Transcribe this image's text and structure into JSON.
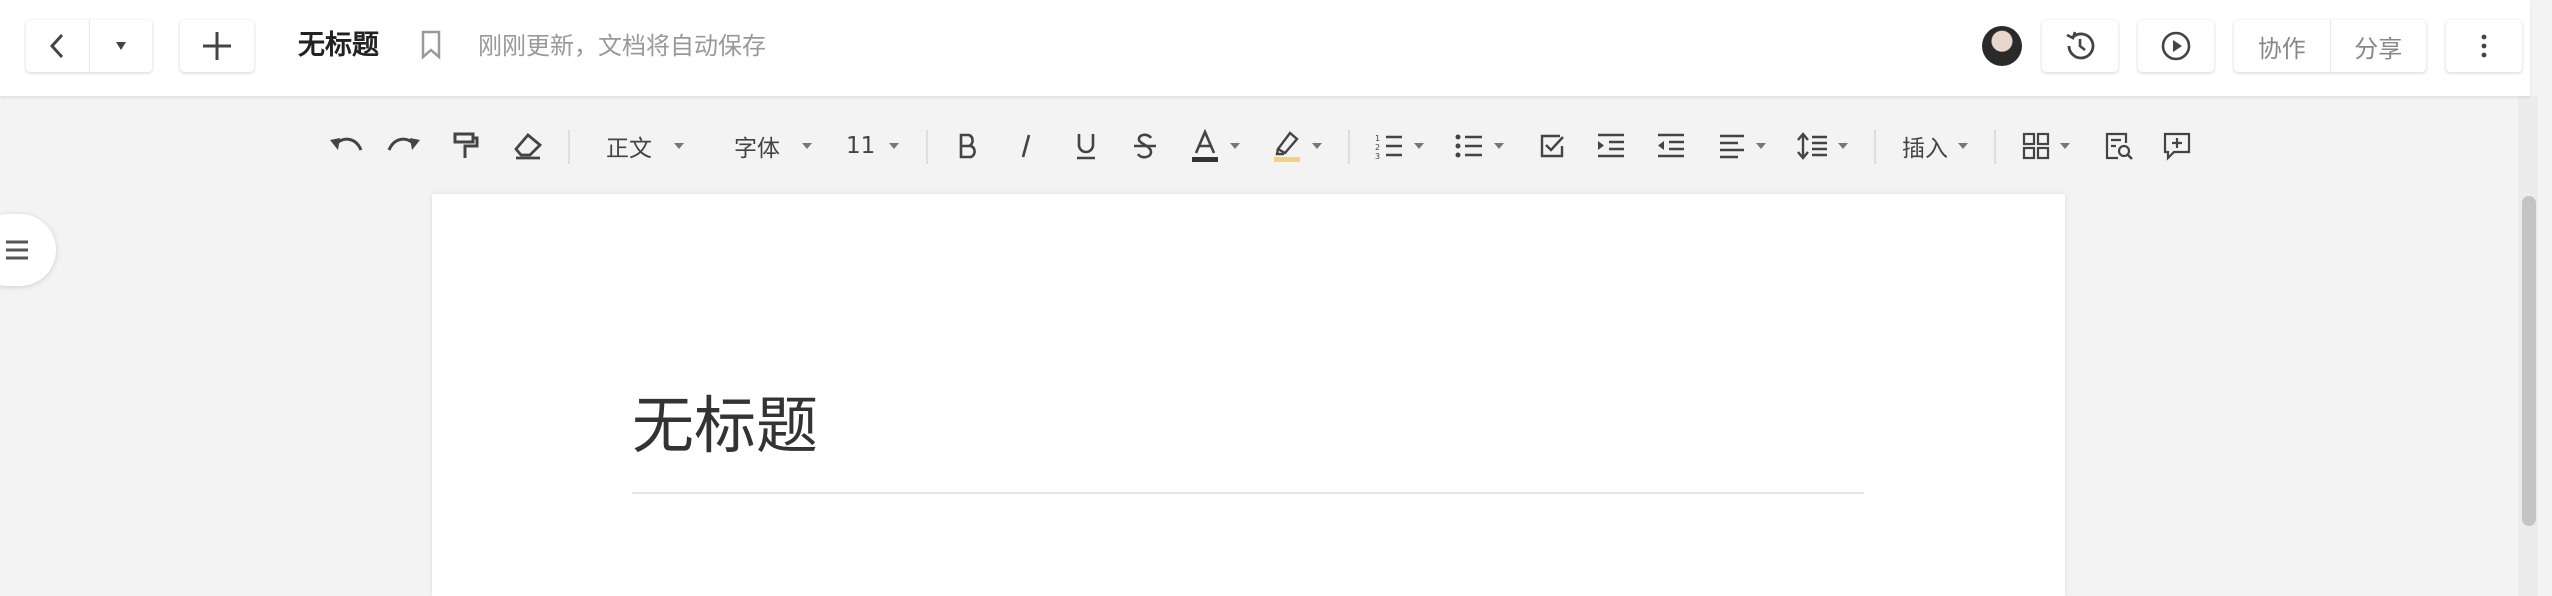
{
  "header": {
    "doc_name": "无标题",
    "save_status": "刚刚更新，文档将自动保存",
    "collaborate_label": "协作",
    "share_label": "分享"
  },
  "toolbar": {
    "paragraph_style": "正文",
    "font_family": "字体",
    "font_size": "11",
    "insert_label": "插入",
    "font_color_underline": "#333333",
    "highlight_underline": "#f5d27a"
  },
  "document": {
    "title": "无标题"
  },
  "icons": {
    "back": "chevron-left-icon",
    "dropdown": "caret-down-icon",
    "new": "plus-icon",
    "bookmark": "bookmark-icon",
    "history": "history-icon",
    "present": "play-icon",
    "more": "more-vertical-icon",
    "outline": "menu-icon"
  }
}
